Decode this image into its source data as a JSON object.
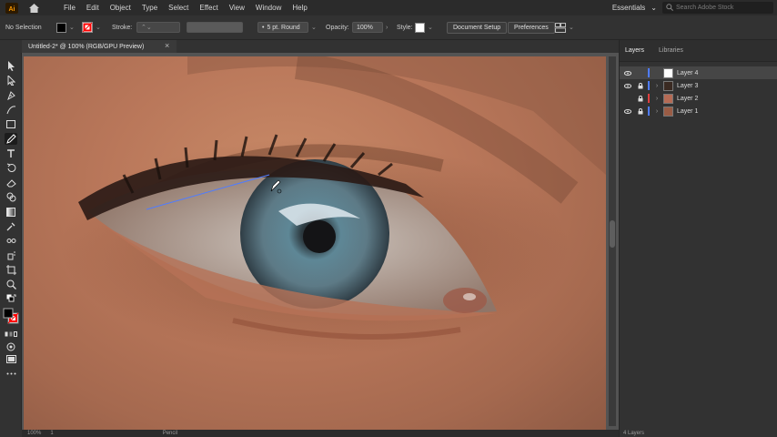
{
  "menubar": {
    "logo": "Ai",
    "menus": [
      "File",
      "Edit",
      "Object",
      "Type",
      "Select",
      "Effect",
      "View",
      "Window",
      "Help"
    ],
    "workspace": "Essentials",
    "search_placeholder": "Search Adobe Stock"
  },
  "controlbar": {
    "selection_label": "No Selection",
    "stroke_label": "Stroke:",
    "brush_label": "5 pt. Round",
    "opacity_label": "Opacity:",
    "opacity_value": "100%",
    "style_label": "Style:",
    "document_setup": "Document Setup",
    "preferences": "Preferences"
  },
  "document": {
    "tab_title": "Untitled-2* @ 100% (RGB/GPU Preview)"
  },
  "statusbar": {
    "zoom": "100%",
    "artboard": "1",
    "tool": "Pencil"
  },
  "panel": {
    "tabs": [
      "Layers",
      "Libraries"
    ],
    "layers": [
      {
        "name": "Layer 4",
        "color": "#4f7cff",
        "selected": true
      },
      {
        "name": "Layer 3",
        "color": "#4f7cff",
        "selected": false
      },
      {
        "name": "Layer 2",
        "color": "#e04040",
        "selected": false
      },
      {
        "name": "Layer 1",
        "color": "#4f7cff",
        "selected": false
      }
    ],
    "footer": "4 Layers"
  },
  "colors": {
    "accent": "#4f7cff",
    "fill": "#000000",
    "stroke": "#ff0000"
  }
}
